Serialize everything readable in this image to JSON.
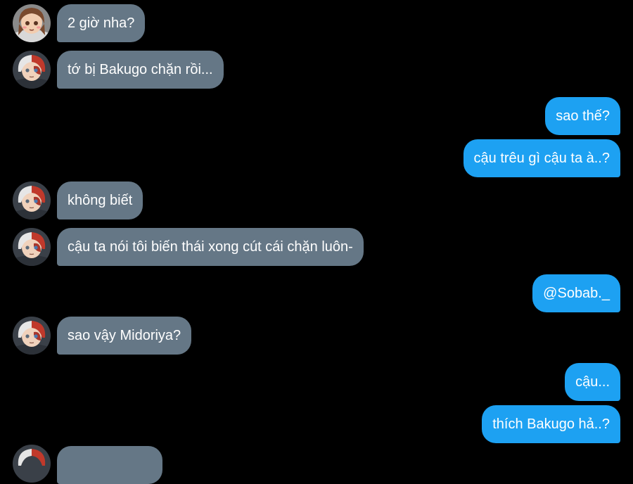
{
  "conversation": {
    "messages": [
      {
        "sender": "uraraka",
        "direction": "incoming",
        "text": "2 giờ nha?"
      },
      {
        "sender": "todoroki",
        "direction": "incoming",
        "text": "tớ bị Bakugo chặn rồi..."
      },
      {
        "sender": "me",
        "direction": "outgoing",
        "text": "sao thế?"
      },
      {
        "sender": "me",
        "direction": "outgoing",
        "text": "cậu trêu gì cậu ta à..?"
      },
      {
        "sender": "todoroki",
        "direction": "incoming",
        "text": "không  biết"
      },
      {
        "sender": "todoroki",
        "direction": "incoming",
        "text": "cậu ta nói tôi biến thái xong cút cái chặn luôn-"
      },
      {
        "sender": "me",
        "direction": "outgoing",
        "text": "@Sobab._"
      },
      {
        "sender": "todoroki",
        "direction": "incoming",
        "text": "sao vậy Midoriya?"
      },
      {
        "sender": "me",
        "direction": "outgoing",
        "text": "cậu..."
      },
      {
        "sender": "me",
        "direction": "outgoing",
        "text": "thích Bakugo hả..?"
      }
    ]
  },
  "theme": {
    "background": "#000000",
    "incoming_bubble": "#657786",
    "outgoing_bubble": "#1da1f2",
    "text": "#ffffff"
  },
  "icons": {
    "avatar_uraraka": "brown-haired-girl-avatar-icon",
    "avatar_todoroki": "red-white-haired-boy-avatar-icon"
  }
}
